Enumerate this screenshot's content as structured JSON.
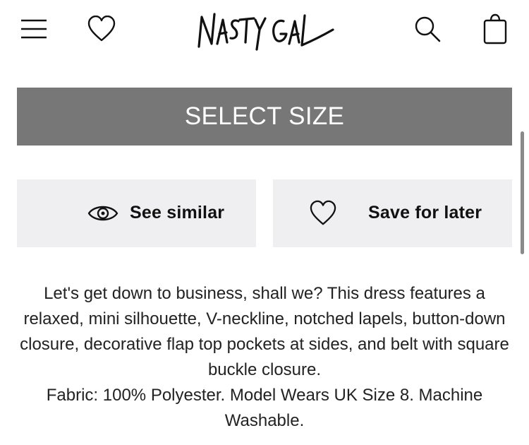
{
  "header": {
    "logo_text": "NASTY GAL",
    "icons": {
      "menu": "hamburger-menu-icon",
      "wishlist": "heart-icon",
      "search": "search-icon",
      "bag": "shopping-bag-icon"
    }
  },
  "product": {
    "select_size_label": "SELECT SIZE",
    "see_similar_label": "See similar",
    "save_for_later_label": "Save for later",
    "description_text": "Let's get down to business, shall we? This dress features a relaxed, mini silhouette, V-neckline, notched lapels, button-down closure, decorative flap top pockets at sides, and belt with square buckle closure.",
    "fabric_text": "Fabric: 100% Polyester. Model Wears UK Size 8. Machine Washable."
  },
  "colors": {
    "select_size_bg": "#777777",
    "action_button_bg": "#efeff1",
    "text": "#111111",
    "background": "#ffffff"
  }
}
